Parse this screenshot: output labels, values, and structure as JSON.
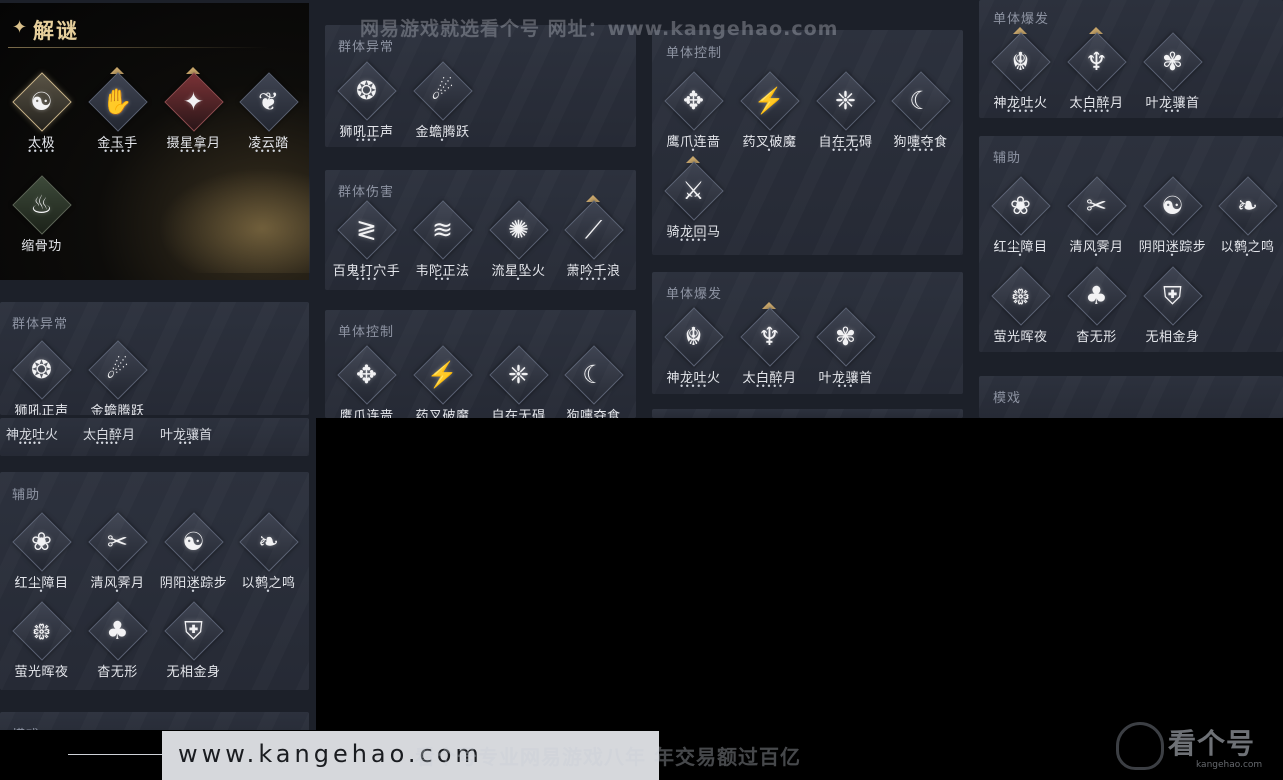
{
  "watermarks": {
    "top": "网易游戏就选看个号   网址：www.kangehao.com",
    "bottom_url": "www.kangehao.com",
    "bottom_slogan": "看个号专业网易游戏八年  年交易额过百亿",
    "logo_text": "看个号",
    "logo_sub": "kangehao.com"
  },
  "header": {
    "title": "解谜",
    "icon": "sparkle-icon"
  },
  "jiemi": [
    {
      "name": "太极",
      "dots": "•••••",
      "glyph": "☯",
      "style": "gold",
      "tri": false
    },
    {
      "name": "金玉手",
      "dots": "•••••",
      "glyph": "✋",
      "style": "",
      "tri": true
    },
    {
      "name": "摄星拿月",
      "dots": "•••••",
      "glyph": "✦",
      "style": "red",
      "tri": true
    },
    {
      "name": "凌云踏",
      "dots": "•••••",
      "glyph": "❦",
      "style": "",
      "tri": false
    },
    {
      "name": "缩骨功",
      "dots": "",
      "glyph": "♨",
      "style": "dark",
      "tri": false
    }
  ],
  "sections": {
    "qunti_yichang": "群体异常",
    "qunti_shanghai": "群体伤害",
    "danti_kongzhi": "单体控制",
    "danti_baofa": "单体爆发",
    "fuzhu": "辅助",
    "moxi": "模戏",
    "partial": "模戏"
  },
  "skills": {
    "shihou": {
      "name": "狮吼正声",
      "dots": "••••",
      "glyph": "❂"
    },
    "jinchan": {
      "name": "金蟾腾跃",
      "dots": "•",
      "glyph": "☄"
    },
    "baigui": {
      "name": "百鬼打穴手",
      "dots": "••••",
      "glyph": "≷"
    },
    "weituo": {
      "name": "韦陀正法",
      "dots": "•••",
      "glyph": "≋"
    },
    "liuxing": {
      "name": "流星坠火",
      "dots": "•",
      "glyph": "✺"
    },
    "xiaoyin": {
      "name": "萧吟千浪",
      "dots": "•••••",
      "glyph": "⟋"
    },
    "yingzhua": {
      "name": "鹰爪连啬",
      "dots": "•",
      "glyph": "✥"
    },
    "yaocha": {
      "name": "药叉破魔",
      "dots": "•",
      "glyph": "⚡"
    },
    "zizai": {
      "name": "自在无碍",
      "dots": "•••••",
      "glyph": "❈"
    },
    "goushi": {
      "name": "狗嚏夺食",
      "dots": "•••••",
      "glyph": "☾"
    },
    "qilong": {
      "name": "骑龙回马",
      "dots": "•••••",
      "glyph": "⚔"
    },
    "shenlong": {
      "name": "神龙吐火",
      "dots": "•••••",
      "glyph": "☬"
    },
    "taibai": {
      "name": "太白醉月",
      "dots": "•••••",
      "glyph": "♆"
    },
    "yelong": {
      "name": "叶龙骧首",
      "dots": "•••",
      "glyph": "✾"
    },
    "hongchen": {
      "name": "红尘障目",
      "dots": "•",
      "glyph": "❀"
    },
    "qingfeng": {
      "name": "清风霁月",
      "dots": "•",
      "glyph": "✂"
    },
    "yinyang": {
      "name": "阴阳迷踪步",
      "dots": "•",
      "glyph": "☯"
    },
    "yihe": {
      "name": "以鹩之鸣",
      "dots": "•",
      "glyph": "❧"
    },
    "yingguang": {
      "name": "萤光晖夜",
      "dots": "",
      "glyph": "᪥"
    },
    "yaowu": {
      "name": "杳无形",
      "dots": "",
      "glyph": "♣"
    },
    "wuxiang": {
      "name": "无相金身",
      "dots": "",
      "glyph": "⛨"
    },
    "goushi_cut": {
      "name": "狗嚏夺食",
      "dots": "",
      "glyph": "☾"
    },
    "yingzhua_cut": {
      "name": "鹰爪连啬",
      "dots": "",
      "glyph": "✥"
    },
    "yaocha_cut": {
      "name": "药叉破魔",
      "dots": "",
      "glyph": "⚡"
    },
    "zizai_cut": {
      "name": "自在无碍",
      "dots": "",
      "glyph": "❈"
    }
  }
}
